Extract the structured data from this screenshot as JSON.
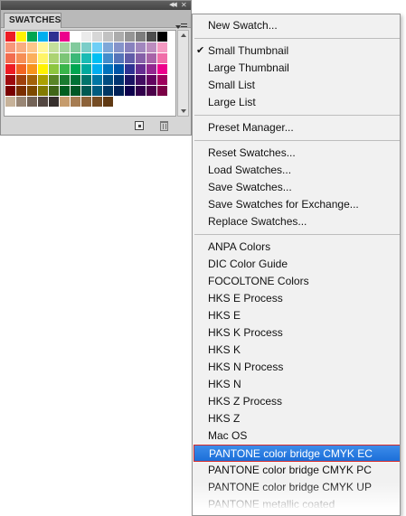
{
  "panel": {
    "tab_label": "SWATCHES",
    "swatch_rows": [
      [
        "#ed1c24",
        "#fff200",
        "#00a651",
        "#00aeef",
        "#2e3192",
        "#ec008c",
        "#ffffff",
        "#ebebeb",
        "#d7d7d7",
        "#c2c2c2",
        "#acacac",
        "#959595",
        "#7d7d7d",
        "#4d4d4d",
        "#000000"
      ],
      [
        "#f7977a",
        "#f9ad81",
        "#fdc68a",
        "#fff799",
        "#c4df9b",
        "#a3d39c",
        "#82ca9d",
        "#7bcdc8",
        "#6ecff6",
        "#7ea7d8",
        "#8493ca",
        "#8882be",
        "#a187be",
        "#bc8dbf",
        "#f49ac2"
      ],
      [
        "#f26c4f",
        "#f68e55",
        "#fbaf5c",
        "#fff467",
        "#acd372",
        "#7cc576",
        "#3bb878",
        "#1abbb4",
        "#00bff3",
        "#438ccb",
        "#5574b9",
        "#605ca8",
        "#855fa8",
        "#a763a8",
        "#f06ea9"
      ],
      [
        "#ed1c24",
        "#f26522",
        "#f7941d",
        "#fff200",
        "#8dc63f",
        "#39b54a",
        "#00a651",
        "#00a99d",
        "#00aeef",
        "#0072bc",
        "#0054a6",
        "#2e3192",
        "#662d91",
        "#92278f",
        "#ec008c"
      ],
      [
        "#9e0b0f",
        "#a0410d",
        "#a3620a",
        "#aba000",
        "#598527",
        "#197b30",
        "#007236",
        "#00746b",
        "#0076a3",
        "#004b80",
        "#003471",
        "#1b1464",
        "#440e62",
        "#630460",
        "#9e005d"
      ],
      [
        "#790000",
        "#7b2e00",
        "#7d4900",
        "#827b00",
        "#406618",
        "#005e20",
        "#005826",
        "#005952",
        "#005b7f",
        "#003663",
        "#002157",
        "#0d004c",
        "#32004b",
        "#4b0049",
        "#7b0046"
      ],
      [
        "#c7b299",
        "#998675",
        "#736357",
        "#534741",
        "#37302d",
        "#c69c6d",
        "#a67c52",
        "#8c6239",
        "#754c24",
        "#603913"
      ]
    ]
  },
  "menu": {
    "groups": [
      [
        {
          "label": "New Swatch...",
          "checked": false
        }
      ],
      [
        {
          "label": "Small Thumbnail",
          "checked": true
        },
        {
          "label": "Large Thumbnail",
          "checked": false
        },
        {
          "label": "Small List",
          "checked": false
        },
        {
          "label": "Large List",
          "checked": false
        }
      ],
      [
        {
          "label": "Preset Manager...",
          "checked": false
        }
      ],
      [
        {
          "label": "Reset Swatches...",
          "checked": false
        },
        {
          "label": "Load Swatches...",
          "checked": false
        },
        {
          "label": "Save Swatches...",
          "checked": false
        },
        {
          "label": "Save Swatches for Exchange...",
          "checked": false
        },
        {
          "label": "Replace Swatches...",
          "checked": false
        }
      ],
      [
        {
          "label": "ANPA Colors",
          "checked": false
        },
        {
          "label": "DIC Color Guide",
          "checked": false
        },
        {
          "label": "FOCOLTONE Colors",
          "checked": false
        },
        {
          "label": "HKS E Process",
          "checked": false
        },
        {
          "label": "HKS E",
          "checked": false
        },
        {
          "label": "HKS K Process",
          "checked": false
        },
        {
          "label": "HKS K",
          "checked": false
        },
        {
          "label": "HKS N Process",
          "checked": false
        },
        {
          "label": "HKS N",
          "checked": false
        },
        {
          "label": "HKS Z Process",
          "checked": false
        },
        {
          "label": "HKS Z",
          "checked": false
        },
        {
          "label": "Mac OS",
          "checked": false
        },
        {
          "label": "PANTONE color bridge CMYK EC",
          "checked": false,
          "highlighted": true
        },
        {
          "label": "PANTONE color bridge CMYK PC",
          "checked": false
        },
        {
          "label": "PANTONE color bridge CMYK UP",
          "checked": false
        },
        {
          "label": "PANTONE metallic coated",
          "checked": false
        }
      ]
    ]
  }
}
